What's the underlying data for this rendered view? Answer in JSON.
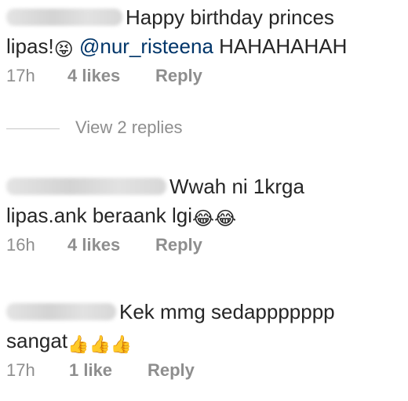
{
  "comments": [
    {
      "text_line1": "Happy birthday princes",
      "text_line2_pre": "lipas!",
      "emoji_1": "😝",
      "mention": "@nur_risteena",
      "text_line2_post": " HAHAHAHAH",
      "time": "17h",
      "likes": "4 likes",
      "reply": "Reply"
    },
    {
      "text_line1": "Wwah ni 1krga",
      "text_line2": "lipas.ank beraank lgi",
      "emoji_1": "😂",
      "emoji_2": "😂",
      "time": "16h",
      "likes": "4 likes",
      "reply": "Reply"
    },
    {
      "text_line1": "Kek mmg sedappppppp",
      "text_line2": "sangat",
      "emoji_1": "👍",
      "emoji_2": "👍",
      "emoji_3": "👍",
      "time": "17h",
      "likes": "1 like",
      "reply": "Reply"
    }
  ],
  "view_replies": "View 2 replies"
}
